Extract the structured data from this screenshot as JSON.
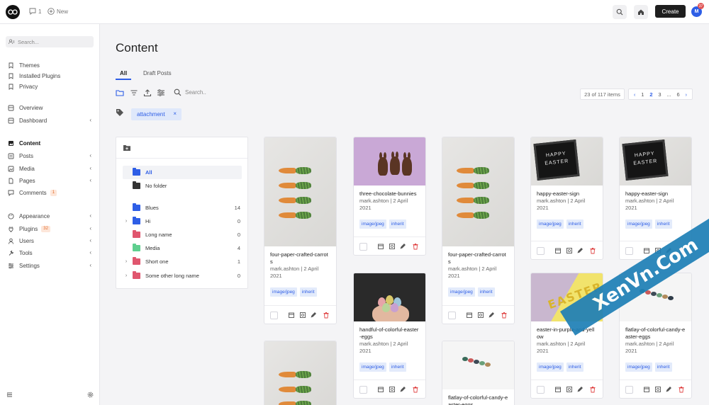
{
  "topbar": {
    "comments_count": "1",
    "new_label": "New",
    "create_label": "Create",
    "avatar_initial": "M",
    "avatar_badge": "37"
  },
  "sidebar": {
    "search_placeholder": "Search...",
    "items": [
      {
        "label": "Themes",
        "icon": "bookmark-icon"
      },
      {
        "label": "Installed Plugins",
        "icon": "bookmark-icon"
      },
      {
        "label": "Privacy",
        "icon": "bookmark-icon"
      },
      {
        "label": "Overview",
        "icon": "grid-icon"
      },
      {
        "label": "Dashboard",
        "icon": "grid-icon"
      },
      {
        "label": "Content",
        "icon": "image-icon"
      },
      {
        "label": "Posts",
        "icon": "list-icon"
      },
      {
        "label": "Media",
        "icon": "media-icon"
      },
      {
        "label": "Pages",
        "icon": "page-icon"
      },
      {
        "label": "Comments",
        "icon": "comment-icon",
        "badge": "1"
      },
      {
        "label": "Appearance",
        "icon": "palette-icon"
      },
      {
        "label": "Plugins",
        "icon": "plug-icon",
        "badge": "32"
      },
      {
        "label": "Users",
        "icon": "users-icon"
      },
      {
        "label": "Tools",
        "icon": "tools-icon"
      },
      {
        "label": "Settings",
        "icon": "settings-icon"
      }
    ]
  },
  "main": {
    "title": "Content",
    "tabs": [
      "All",
      "Draft Posts"
    ],
    "search_placeholder": "Search..",
    "count_text": "23 of 117 items",
    "pages": [
      "1",
      "2",
      "3",
      "...",
      "6"
    ],
    "filter_tag": "attachment"
  },
  "folders": [
    {
      "name": "All",
      "color": "#2e5ee6",
      "count": ""
    },
    {
      "name": "No folder",
      "color": "#333333",
      "count": ""
    },
    {
      "name": "Blues",
      "color": "#2e5ee6",
      "count": "14"
    },
    {
      "name": "Hi",
      "color": "#2e5ee6",
      "count": "0"
    },
    {
      "name": "Long name",
      "color": "#e0566e",
      "count": "0"
    },
    {
      "name": "Media",
      "color": "#5fcf8f",
      "count": "4"
    },
    {
      "name": "Short one",
      "color": "#e0566e",
      "count": "1"
    },
    {
      "name": "Some other long name",
      "color": "#e0566e",
      "count": "0"
    }
  ],
  "cards": [
    {
      "name": "four-paper-crafted-carrots",
      "meta": "mark.ashton | 2 April 2021",
      "tags": [
        "image/jpeg",
        "inherit"
      ]
    },
    {
      "name": "three-chocolate-bunnies",
      "meta": "mark.ashton | 2 April 2021",
      "tags": [
        "image/jpeg",
        "inherit"
      ]
    },
    {
      "name": "four-paper-crafted-carrots",
      "meta": "mark.ashton | 2 April 2021",
      "tags": [
        "image/jpeg",
        "inherit"
      ]
    },
    {
      "name": "happy-easter-sign",
      "meta": "mark.ashton | 2 April 2021",
      "tags": [
        "image/jpeg",
        "inherit"
      ]
    },
    {
      "name": "happy-easter-sign",
      "meta": "mark.ashton | 2 April 2021",
      "tags": [
        "image/jpeg",
        "inherit"
      ]
    },
    {
      "name": "handful-of-colorful-easter-eggs",
      "meta": "mark.ashton | 2 April 2021",
      "tags": [
        "image/jpeg",
        "inherit"
      ]
    },
    {
      "name": "easter-in-purple-and-yellow",
      "meta": "mark.ashton | 2 April 2021",
      "tags": [
        "image/jpeg",
        "inherit"
      ]
    },
    {
      "name": "flatlay-of-colorful-candy-easter-eggs",
      "meta": "mark.ashton | 2 April 2021",
      "tags": [
        "image/jpeg",
        "inherit"
      ]
    },
    {
      "name": "flatlay-of-colorful-candy-easter-eggs",
      "meta": "",
      "tags": []
    }
  ],
  "sign_text": {
    "line1": "HAPPY",
    "line2": "EASTER"
  },
  "photo_text": "EASTER",
  "watermark": "XenVn.Com"
}
